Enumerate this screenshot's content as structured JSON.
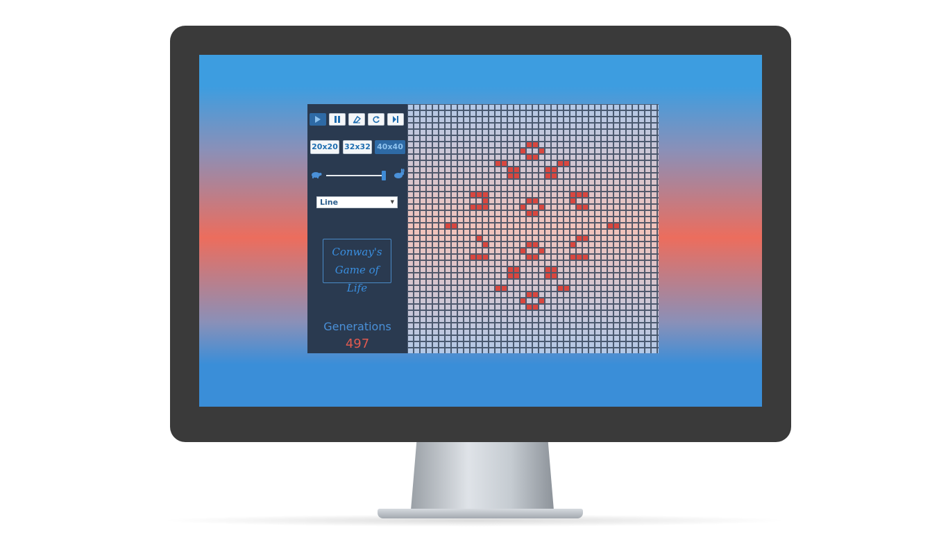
{
  "controls": {
    "play": "play-icon",
    "pause": "pause-icon",
    "clear": "eraser-icon",
    "reset": "reset-icon",
    "step": "step-icon"
  },
  "board_sizes": [
    {
      "label": "20x20",
      "active": false
    },
    {
      "label": "32x32",
      "active": false
    },
    {
      "label": "40x40",
      "active": true
    }
  ],
  "speed": {
    "slow_icon": "turtle-icon",
    "fast_icon": "rabbit-icon",
    "level": 1.0
  },
  "pattern_select": {
    "value": "Line"
  },
  "logo": {
    "line1": "Conway's",
    "line2": "Game of Life"
  },
  "stats": {
    "generations_label": "Generations",
    "generations_value": "497"
  },
  "grid": {
    "columns": 40,
    "rows": 40,
    "live_cells": [
      [
        19,
        6
      ],
      [
        20,
        6
      ],
      [
        18,
        7
      ],
      [
        21,
        7
      ],
      [
        19,
        8
      ],
      [
        20,
        8
      ],
      [
        14,
        9
      ],
      [
        15,
        9
      ],
      [
        24,
        9
      ],
      [
        25,
        9
      ],
      [
        16,
        10
      ],
      [
        17,
        10
      ],
      [
        22,
        10
      ],
      [
        23,
        10
      ],
      [
        16,
        11
      ],
      [
        17,
        11
      ],
      [
        22,
        11
      ],
      [
        23,
        11
      ],
      [
        10,
        14
      ],
      [
        11,
        14
      ],
      [
        12,
        14
      ],
      [
        26,
        14
      ],
      [
        27,
        14
      ],
      [
        28,
        14
      ],
      [
        12,
        15
      ],
      [
        26,
        15
      ],
      [
        19,
        15
      ],
      [
        20,
        15
      ],
      [
        18,
        16
      ],
      [
        21,
        16
      ],
      [
        19,
        17
      ],
      [
        20,
        17
      ],
      [
        10,
        16
      ],
      [
        11,
        16
      ],
      [
        12,
        16
      ],
      [
        27,
        16
      ],
      [
        28,
        16
      ],
      [
        6,
        19
      ],
      [
        7,
        19
      ],
      [
        32,
        19
      ],
      [
        33,
        19
      ],
      [
        11,
        21
      ],
      [
        27,
        21
      ],
      [
        28,
        21
      ],
      [
        12,
        22
      ],
      [
        26,
        22
      ],
      [
        19,
        22
      ],
      [
        20,
        22
      ],
      [
        18,
        23
      ],
      [
        21,
        23
      ],
      [
        19,
        24
      ],
      [
        20,
        24
      ],
      [
        10,
        24
      ],
      [
        11,
        24
      ],
      [
        12,
        24
      ],
      [
        26,
        24
      ],
      [
        27,
        24
      ],
      [
        28,
        24
      ],
      [
        16,
        26
      ],
      [
        17,
        26
      ],
      [
        22,
        26
      ],
      [
        23,
        26
      ],
      [
        16,
        27
      ],
      [
        17,
        27
      ],
      [
        22,
        27
      ],
      [
        23,
        27
      ],
      [
        14,
        29
      ],
      [
        15,
        29
      ],
      [
        24,
        29
      ],
      [
        25,
        29
      ],
      [
        19,
        30
      ],
      [
        20,
        30
      ],
      [
        18,
        31
      ],
      [
        21,
        31
      ],
      [
        19,
        32
      ],
      [
        20,
        32
      ]
    ]
  }
}
